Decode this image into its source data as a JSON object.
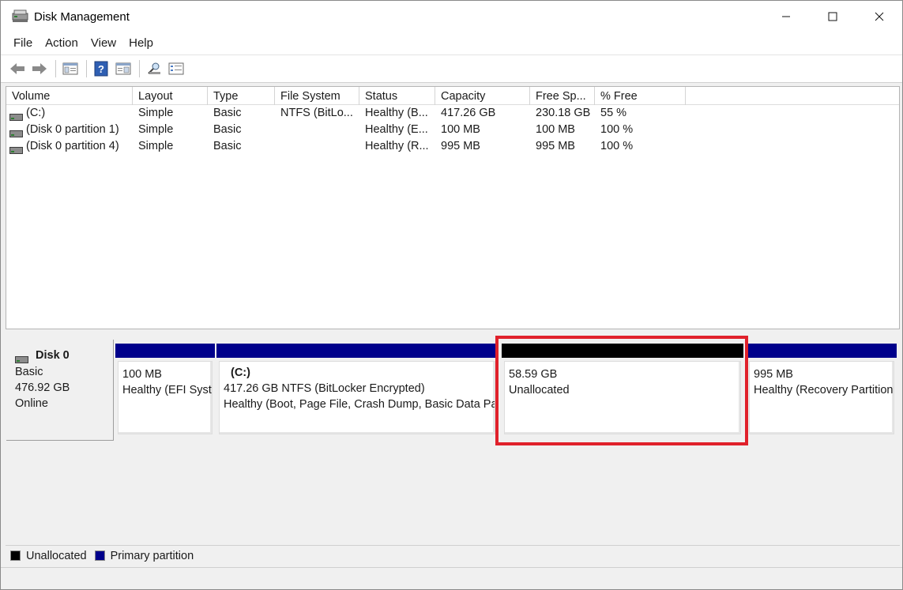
{
  "window": {
    "title": "Disk Management"
  },
  "menu": [
    "File",
    "Action",
    "View",
    "Help"
  ],
  "toolbar": {
    "buttons": [
      "back-arrow-icon",
      "forward-arrow-icon",
      "console-tree-icon",
      "help-icon",
      "properties-icon",
      "rescan-icon",
      "settings-icon"
    ]
  },
  "volume_list": {
    "columns": [
      "Volume",
      "Layout",
      "Type",
      "File System",
      "Status",
      "Capacity",
      "Free Sp...",
      "% Free"
    ],
    "rows": [
      [
        "(C:)",
        "Simple",
        "Basic",
        "NTFS (BitLo...",
        "Healthy (B...",
        "417.26 GB",
        "230.18 GB",
        "55 %"
      ],
      [
        "(Disk 0 partition 1)",
        "Simple",
        "Basic",
        "",
        "Healthy (E...",
        "100 MB",
        "100 MB",
        "100 %"
      ],
      [
        "(Disk 0 partition 4)",
        "Simple",
        "Basic",
        "",
        "Healthy (R...",
        "995 MB",
        "995 MB",
        "100 %"
      ]
    ]
  },
  "disk": {
    "name": "Disk 0",
    "type": "Basic",
    "size": "476.92 GB",
    "state": "Online",
    "partitions": [
      {
        "name": "",
        "size": "100 MB",
        "status": "Healthy (EFI Syst",
        "kind": "primary"
      },
      {
        "name": "(C:)",
        "size": "417.26 GB NTFS (BitLocker Encrypted)",
        "status": "Healthy (Boot, Page File, Crash Dump, Basic Data Pa",
        "kind": "primary"
      },
      {
        "name": "",
        "size": "58.59 GB",
        "status": "Unallocated",
        "kind": "unallocated"
      },
      {
        "name": "",
        "size": "995 MB",
        "status": "Healthy (Recovery Partition",
        "kind": "primary"
      }
    ]
  },
  "legend": [
    {
      "label": "Unallocated",
      "color": "#000000"
    },
    {
      "label": "Primary partition",
      "color": "#00008b"
    }
  ],
  "colors": {
    "primary": "#00008b",
    "unallocated": "#000000",
    "highlight": "#e0212b"
  }
}
